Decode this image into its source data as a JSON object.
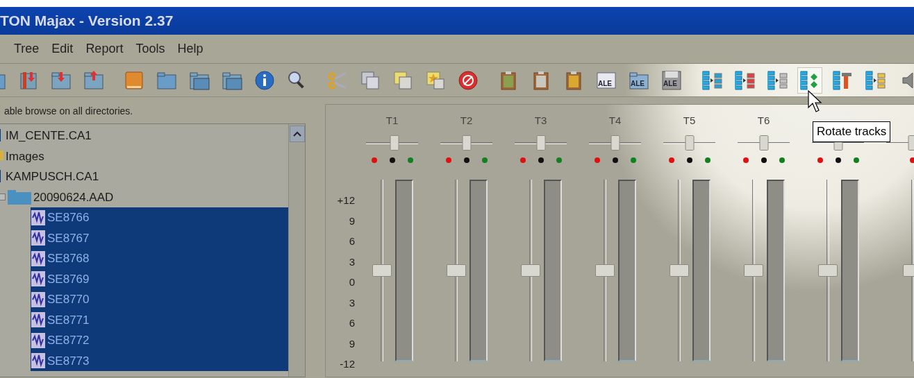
{
  "window": {
    "title": "TON Majax - Version 2.37"
  },
  "menu": [
    "Tree",
    "Edit",
    "Report",
    "Tools",
    "Help"
  ],
  "toolbar": [
    {
      "kind": "folder",
      "hovered": false
    },
    {
      "kind": "phone-down",
      "hovered": false
    },
    {
      "kind": "folder-down",
      "hovered": false
    },
    {
      "kind": "folder-up",
      "hovered": false
    },
    {
      "kind": "separator"
    },
    {
      "kind": "book",
      "hovered": false
    },
    {
      "kind": "folder",
      "hovered": false
    },
    {
      "kind": "folders",
      "hovered": false
    },
    {
      "kind": "folders",
      "hovered": false
    },
    {
      "kind": "info",
      "hovered": false
    },
    {
      "kind": "search",
      "hovered": false
    },
    {
      "kind": "separator"
    },
    {
      "kind": "scissors",
      "hovered": false
    },
    {
      "kind": "copy",
      "hovered": false
    },
    {
      "kind": "paste",
      "hovered": false
    },
    {
      "kind": "star",
      "hovered": false
    },
    {
      "kind": "cancel",
      "hovered": false
    },
    {
      "kind": "separator"
    },
    {
      "kind": "clipboard",
      "color": "#8aa050",
      "hovered": false
    },
    {
      "kind": "clipboard",
      "color": "#c8c8c0",
      "hovered": false
    },
    {
      "kind": "clipboard",
      "color": "#d8a830",
      "hovered": false
    },
    {
      "kind": "ale",
      "label": "ALE",
      "hovered": false
    },
    {
      "kind": "ale-folder",
      "label": "ALE",
      "hovered": false
    },
    {
      "kind": "ale-disk",
      "label": "ALE",
      "hovered": false
    },
    {
      "kind": "separator"
    },
    {
      "kind": "tracks-copy",
      "hovered": false
    },
    {
      "kind": "tracks-split",
      "hovered": false
    },
    {
      "kind": "tracks-list",
      "hovered": false
    },
    {
      "kind": "tracks-rotate",
      "hovered": true
    },
    {
      "kind": "tracks-tool",
      "hovered": false
    },
    {
      "kind": "tracks-merge",
      "hovered": false
    },
    {
      "kind": "speaker",
      "hovered": false
    }
  ],
  "hint": "able browse on all directories.",
  "tree": [
    {
      "label": "IM_CENTE.CA1",
      "kind": "case",
      "selected": false
    },
    {
      "label": "Images",
      "kind": "images",
      "selected": false
    },
    {
      "label": "KAMPUSCH.CA1",
      "kind": "case",
      "selected": false,
      "children": [
        {
          "label": "20090624.AAD",
          "kind": "folder",
          "selected": false,
          "expanded": true,
          "children": [
            {
              "label": "SE8766",
              "kind": "audio",
              "selected": true
            },
            {
              "label": "SE8767",
              "kind": "audio",
              "selected": true
            },
            {
              "label": "SE8768",
              "kind": "audio",
              "selected": true
            },
            {
              "label": "SE8769",
              "kind": "audio",
              "selected": true
            },
            {
              "label": "SE8770",
              "kind": "audio",
              "selected": true
            },
            {
              "label": "SE8771",
              "kind": "audio",
              "selected": true
            },
            {
              "label": "SE8772",
              "kind": "audio",
              "selected": true
            },
            {
              "label": "SE8773",
              "kind": "audio",
              "selected": true
            }
          ]
        }
      ]
    }
  ],
  "mixer": {
    "scale": [
      "+12",
      "9",
      "6",
      "3",
      "0",
      "3",
      "6",
      "9",
      "-12"
    ],
    "tracks": [
      {
        "label": "T1",
        "pan": {
          "level": 0.55
        },
        "fader": {
          "level": 0.5
        },
        "indicators": [
          {
            "color": "#e01010"
          },
          {
            "color": "#101010"
          },
          {
            "color": "#108020"
          }
        ]
      },
      {
        "label": "T2",
        "pan": {
          "level": 0.5
        },
        "fader": {
          "level": 0.5
        },
        "indicators": [
          {
            "color": "#e01010"
          },
          {
            "color": "#101010"
          },
          {
            "color": "#108020"
          }
        ]
      },
      {
        "label": "T3",
        "pan": {
          "level": 0.5
        },
        "fader": {
          "level": 0.5
        },
        "indicators": [
          {
            "color": "#e01010"
          },
          {
            "color": "#101010"
          },
          {
            "color": "#108020"
          }
        ]
      },
      {
        "label": "T4",
        "pan": {
          "level": 0.5
        },
        "fader": {
          "level": 0.5
        },
        "indicators": [
          {
            "color": "#e01010"
          },
          {
            "color": "#101010"
          },
          {
            "color": "#108020"
          }
        ]
      },
      {
        "label": "T5",
        "pan": {
          "level": 0.5
        },
        "fader": {
          "level": 0.5
        },
        "indicators": [
          {
            "color": "#e01010"
          },
          {
            "color": "#101010"
          },
          {
            "color": "#108020"
          }
        ]
      },
      {
        "label": "T6",
        "pan": {
          "level": 0.5
        },
        "fader": {
          "level": 0.5
        },
        "indicators": [
          {
            "color": "#e01010"
          },
          {
            "color": "#101010"
          },
          {
            "color": "#108020"
          }
        ]
      },
      {
        "pan": {
          "level": 0.5
        },
        "fader": {
          "level": 0.5
        },
        "indicators": [
          {
            "color": "#e01010"
          },
          {
            "color": "#101010"
          },
          {
            "color": "#108020"
          }
        ]
      },
      {
        "pan": {
          "level": 0.5
        },
        "fader": {
          "level": 0.5
        },
        "indicators": [
          {
            "color": "#e01010"
          }
        ]
      }
    ]
  },
  "tooltip": "Rotate tracks"
}
